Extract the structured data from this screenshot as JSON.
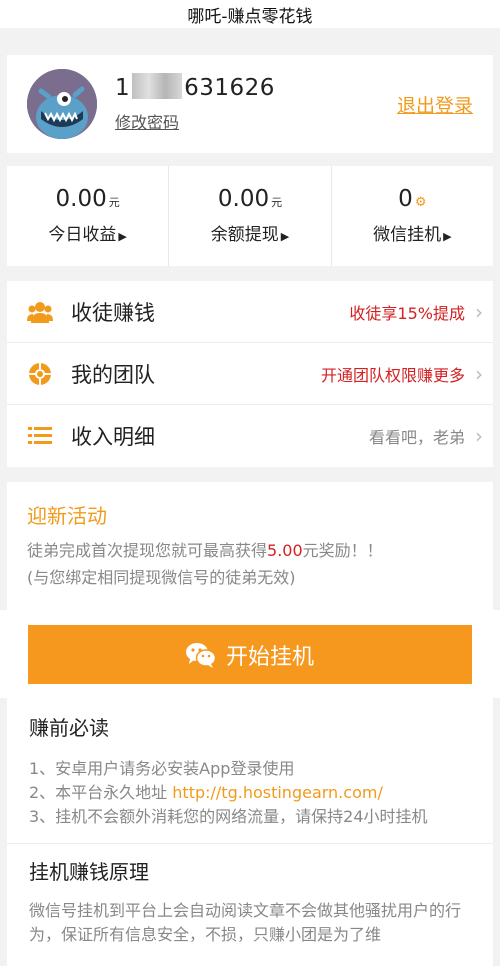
{
  "window": {
    "title": "哪吒-赚点零花钱"
  },
  "profile": {
    "phone_prefix": "1",
    "phone_suffix": "631626",
    "change_password": "修改密码",
    "logout": "退出登录"
  },
  "stats": [
    {
      "value": "0.00",
      "unit": "元",
      "label": "今日收益"
    },
    {
      "value": "0.00",
      "unit": "元",
      "label": "余额提现"
    },
    {
      "value": "0",
      "unit": "",
      "label": "微信挂机"
    }
  ],
  "menu": [
    {
      "icon": "people-icon",
      "label": "收徒赚钱",
      "right": "收徒享15%提成"
    },
    {
      "icon": "lifebuoy-icon",
      "label": "我的团队",
      "right": "开通团队权限赚更多"
    },
    {
      "icon": "list-icon",
      "label": "收入明细",
      "right": "看看吧，老弟"
    }
  ],
  "promo": {
    "title": "迎新活动",
    "line1_before": "徒弟完成首次提现您就可最高获得",
    "line1_amount": "5.00",
    "line1_after": "元奖励！！",
    "line2": "(与您绑定相同提现微信号的徒弟无效)"
  },
  "start_button": {
    "label": "开始挂机"
  },
  "info": {
    "title": "赚前必读",
    "item1": "1、安卓用户请务必安装App登录使用",
    "item2_prefix": "2、本平台永久地址 ",
    "item2_link": "http://tg.hostingearn.com/",
    "item3": "3、挂机不会额外消耗您的网络流量，请保持24小时挂机",
    "principle_title": "挂机赚钱原理",
    "principle_text": "微信号挂机到平台上会自动阅读文章不会做其他骚扰用户的行为，保证所有信息安全，不损，只赚小团是为了维"
  },
  "colors": {
    "accent": "#f7981e",
    "red": "#d42121"
  }
}
